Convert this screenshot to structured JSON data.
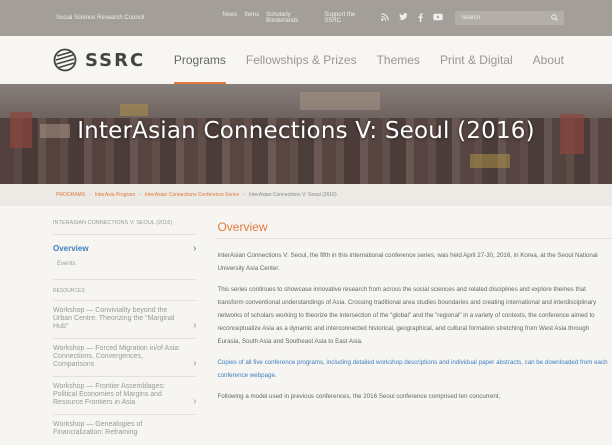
{
  "topbar": {
    "org_name": "Social Science Research Council",
    "links": [
      "News",
      "Items",
      "Scholarly Borderlands",
      "Support the SSRC"
    ],
    "social_icons": [
      "rss-icon",
      "twitter-icon",
      "facebook-icon",
      "youtube-icon"
    ],
    "search_placeholder": "Search",
    "search_icon": "search-icon"
  },
  "header": {
    "logo_text": "SSRC",
    "nav": [
      "Programs",
      "Fellowships & Prizes",
      "Themes",
      "Print & Digital",
      "About"
    ],
    "active_nav": "Programs"
  },
  "hero": {
    "title": "InterAsian Connections V: Seoul (2016)"
  },
  "breadcrumbs": {
    "items": [
      "PROGRAMS",
      "InterAsia Program",
      "InterAsian Connections Conference Series",
      "InterAsian Connections V: Seoul (2016)"
    ]
  },
  "sidebar": {
    "title": "INTERASIAN CONNECTIONS V: SEOUL (2016)",
    "nav_overview": "Overview",
    "nav_events": "Events",
    "resources_label": "RESOURCES",
    "workshops": [
      "Workshop — Conviviality beyond the Urban Centre: Theorizing the \"Marginal Hub\"",
      "Workshop — Forced Migration in/of Asia: Connections, Convergences, Comparisons",
      "Workshop — Frontier Assemblages: Political Economies of Margins and Resource Frontiers in Asia",
      "Workshop — Genealogies of Financialization: Reframing"
    ]
  },
  "main": {
    "heading": "Overview",
    "paragraphs": [
      "InterAsian Connections V: Seoul, the fifth in this international conference series, was held April 27-30, 2016, in Korea, at the Seoul National University Asia Center.",
      "This series continues to showcase innovative research from across the social sciences and related disciplines and explore themes that transform conventional understandings of Asia. Crossing traditional area studies boundaries and creating international and interdisciplinary networks of scholars working to theorize the intersection of the \"global\" and the \"regional\" in a variety of contexts, the conference aimed to reconceptualize Asia as a dynamic and interconnected historical, geographical, and cultural formation stretching from West Asia through Eurasia, South Asia and Southeast Asia to East Asia."
    ],
    "link_paragraph": "Copies of all five conference programs, including detailed workshop descriptions and individual paper abstracts, can be downloaded from each conference webpage.",
    "last_paragraph": "Following a model used in previous conferences, the 2016 Seoul conference comprised ten concurrent,"
  },
  "colors": {
    "accent": "#e07a3c",
    "link": "#3f7fbf",
    "topbar_bg": "#a39e97"
  }
}
